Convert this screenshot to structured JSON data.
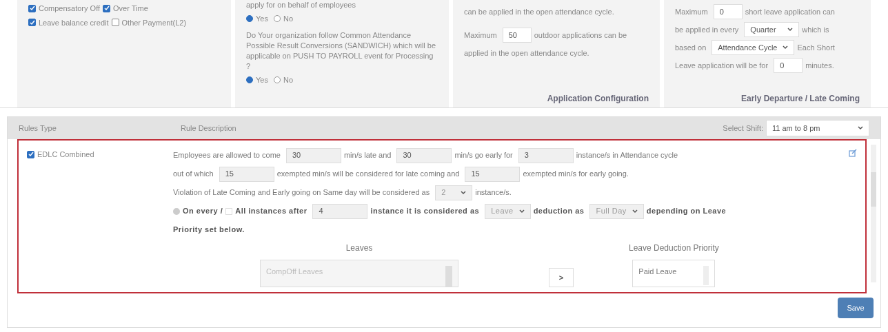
{
  "top_panels": [
    {
      "kind": "checks",
      "options": [
        [
          {
            "label": "Compensatory Off",
            "checked": true
          },
          {
            "label": "Over Time",
            "checked": true
          }
        ],
        [
          {
            "label": "Leave balance credit",
            "checked": true
          },
          {
            "label": "Other Payment(L2)",
            "checked": false
          }
        ]
      ]
    },
    {
      "kind": "questions",
      "questions": [
        {
          "text": "apply for on behalf of employees",
          "options": [
            {
              "label": "Yes",
              "selected": true
            },
            {
              "label": "No",
              "selected": false
            }
          ]
        },
        {
          "text": "Do Your organization follow Common Attendance Possible Result Conversions (SANDWICH) which will be applicable on PUSH TO PAYROLL event for Processing ?",
          "options": [
            {
              "label": "Yes",
              "selected": true
            },
            {
              "label": "No",
              "selected": false
            }
          ]
        }
      ]
    },
    {
      "kind": "config",
      "paragraphs": [
        [
          {
            "kind": "text",
            "text": "can be applied in the open attendance cycle."
          }
        ],
        [
          {
            "kind": "text",
            "text": "Maximum"
          },
          {
            "kind": "input",
            "value": "50"
          },
          {
            "kind": "text",
            "text": "outdoor applications can be"
          },
          {
            "kind": "text",
            "text": "applied in the open attendance cycle."
          }
        ]
      ],
      "title": "Application Configuration"
    },
    {
      "kind": "config",
      "paragraphs": [
        [
          {
            "kind": "text",
            "text": "Maximum"
          },
          {
            "kind": "input",
            "value": "0"
          },
          {
            "kind": "text",
            "text": "short leave application can"
          },
          {
            "kind": "text",
            "text": "be applied in every"
          },
          {
            "kind": "select",
            "value": "Quarter"
          },
          {
            "kind": "text",
            "text": "which is"
          },
          {
            "kind": "text",
            "text": "based on"
          },
          {
            "kind": "select",
            "value": "Attendance Cycle"
          },
          {
            "kind": "text",
            "text": "Each Short"
          },
          {
            "kind": "text",
            "text": "Leave application will be for"
          },
          {
            "kind": "input",
            "value": "0"
          },
          {
            "kind": "text",
            "text": "minutes."
          }
        ]
      ],
      "title": "Early Departure / Late Coming"
    }
  ],
  "table": {
    "columns": [
      "Rules Type",
      "Rule Description"
    ],
    "shift_label": "Select Shift:",
    "shift_value": "11 am to 8 pm"
  },
  "rule": {
    "name": "EDLC Combined",
    "checked": true,
    "lines": [
      [
        {
          "kind": "text",
          "text": "Employees are allowed to come"
        },
        {
          "kind": "input",
          "value": "30"
        },
        {
          "kind": "text",
          "text": "min/s late and"
        },
        {
          "kind": "input",
          "value": "30"
        },
        {
          "kind": "text",
          "text": "min/s go early for"
        },
        {
          "kind": "input",
          "value": "3"
        },
        {
          "kind": "text",
          "text": "instance/s in Attendance cycle"
        }
      ],
      [
        {
          "kind": "text",
          "text": "out of which"
        },
        {
          "kind": "input",
          "value": "15"
        },
        {
          "kind": "text",
          "text": "exempted min/s will be considered for late coming and"
        },
        {
          "kind": "input",
          "value": "15"
        },
        {
          "kind": "text",
          "text": "exempted min/s for early going."
        }
      ],
      [
        {
          "kind": "text",
          "text": "Violation of Late Coming and Early going on Same day will be considered as"
        },
        {
          "kind": "select",
          "value": "2"
        },
        {
          "kind": "text",
          "text": "instance/s."
        }
      ],
      [
        {
          "kind": "radio",
          "text": "On every /",
          "selected": false
        },
        {
          "kind": "checkbox",
          "text": "All instances after",
          "checked": false
        },
        {
          "kind": "input",
          "value": "4"
        },
        {
          "kind": "bold",
          "text": "instance it is considered as"
        },
        {
          "kind": "select",
          "value": "Leave"
        },
        {
          "kind": "bold",
          "text": "deduction as"
        },
        {
          "kind": "select",
          "value": "Full Day"
        },
        {
          "kind": "bold",
          "text": "depending on Leave"
        }
      ],
      [
        {
          "kind": "bold",
          "text": "Priority set below."
        }
      ]
    ],
    "leaves_title": "Leaves",
    "leaves": [
      "CompOff Leaves"
    ],
    "move_button": ">",
    "priority_title": "Leave Deduction Priority",
    "priority": [
      "Paid Leave"
    ]
  },
  "save": "Save"
}
